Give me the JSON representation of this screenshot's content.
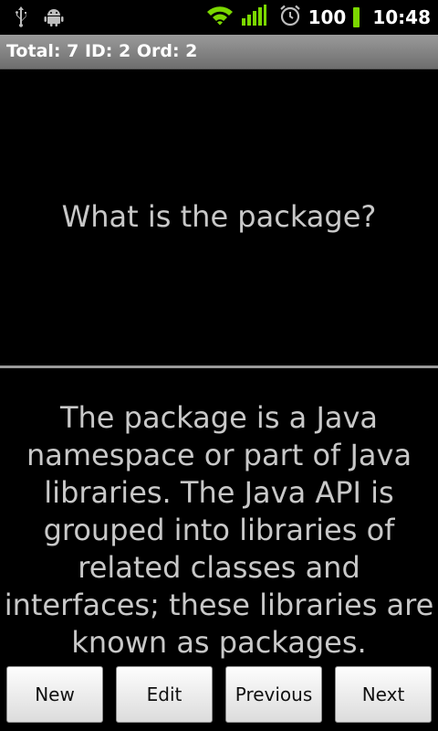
{
  "status_bar": {
    "icons_left": [
      "usb-icon",
      "android-debug-icon"
    ],
    "icons_right": [
      "wifi-icon",
      "signal-icon",
      "alarm-icon"
    ],
    "battery_level": "100",
    "time": "10:48",
    "battery_color": "#7bd800"
  },
  "title_bar": {
    "text": "Total: 7 ID: 2 Ord: 2"
  },
  "card": {
    "question": "What is the package?",
    "answer": "The package is a Java namespace or part of Java libraries. The Java API is grouped into libraries of related classes and interfaces; these libraries are known as packages."
  },
  "buttons": {
    "new": "New",
    "edit": "Edit",
    "previous": "Previous",
    "next": "Next"
  }
}
